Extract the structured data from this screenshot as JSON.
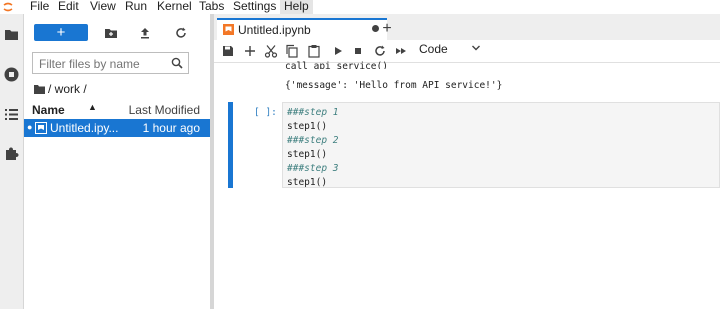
{
  "menu": [
    "File",
    "Edit",
    "View",
    "Run",
    "Kernel",
    "Tabs",
    "Settings",
    "Help"
  ],
  "colors": {
    "accent": "#1976d2",
    "comment": "#408080",
    "prompt": "#307fc1"
  },
  "filebrowser": {
    "new_label": "+",
    "filter_placeholder": "Filter files by name",
    "breadcrumb": "/ work /",
    "col_name": "Name",
    "col_modified": "Last Modified",
    "files": [
      {
        "name": "Untitled.ipy...",
        "modified": "1 hour ago",
        "selected": true
      }
    ]
  },
  "tab": {
    "title": "Untitled.ipynb",
    "add_label": "+"
  },
  "toolbar": {
    "cell_type": "Code"
  },
  "output": {
    "prev_line": "call_api_service()",
    "result": "{'message': 'Hello from API service!'}"
  },
  "cell": {
    "prompt": "[ ]:",
    "lines": [
      "###step 1",
      "step1()",
      "###step 2",
      "step1()",
      "###step 3",
      "step1()"
    ]
  }
}
